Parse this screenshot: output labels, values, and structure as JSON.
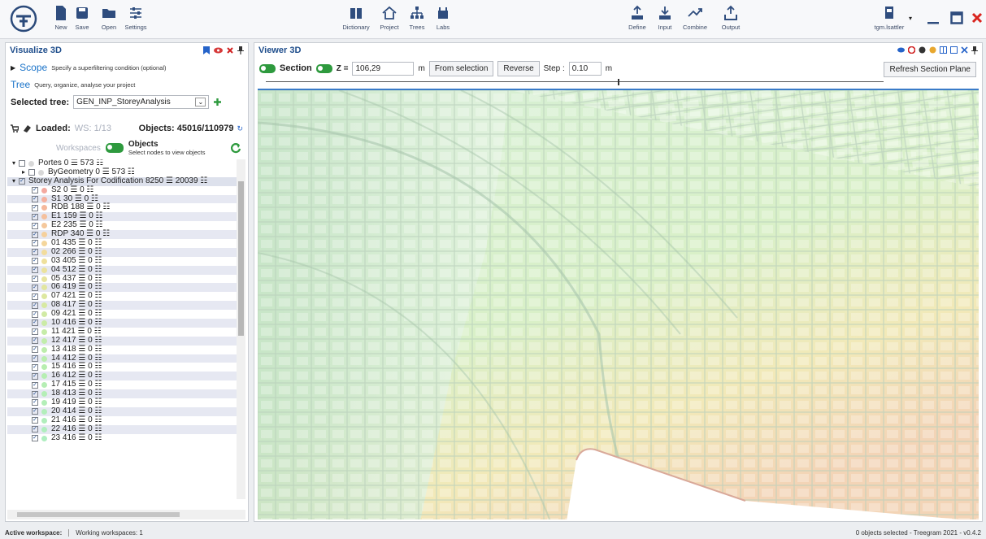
{
  "toolbar": {
    "new": "New",
    "save": "Save",
    "open": "Open",
    "settings": "Settings",
    "dictionary": "Dictionary",
    "project": "Project",
    "trees": "Trees",
    "labs": "Labs",
    "define": "Define",
    "input": "Input",
    "combine": "Combine",
    "output": "Output",
    "user": "tgm.lsattler"
  },
  "left": {
    "title": "Visualize 3D",
    "scope_label": "Scope",
    "scope_hint": "Specify a superfiltering condition (optional)",
    "tree_label": "Tree",
    "tree_hint": "Query, organize, analyse your project",
    "selected_tree_label": "Selected tree:",
    "selected_tree_value": "GEN_INP_StoreyAnalysis",
    "loaded_label": "Loaded:",
    "loaded_ws": "WS: 1/13",
    "objects_count": "Objects: 45016/110979",
    "workspaces_label": "Workspaces",
    "objects_label": "Objects",
    "objects_hint": "Select nodes to view objects"
  },
  "tree": [
    {
      "indent": 6,
      "arrow": "▾",
      "check": "",
      "color": "#d8d8d8",
      "label": "Portes   0 ☰ 573 ☷"
    },
    {
      "indent": 18,
      "arrow": "▸",
      "check": "",
      "color": "#d8d8d8",
      "label": "ByGeometry   0 ☰ 573 ☷"
    },
    {
      "indent": 6,
      "arrow": "▾",
      "check": "✓",
      "color": "",
      "label": "Storey Analysis For Codification   8250 ☰ 20039 ☷"
    },
    {
      "indent": 30,
      "arrow": "",
      "check": "✓",
      "color": "#f4a9a0",
      "label": "S2   0 ☰ 0 ☷"
    },
    {
      "indent": 30,
      "arrow": "",
      "check": "✓",
      "color": "#f5b09e",
      "label": "S1   30 ☰ 0 ☷"
    },
    {
      "indent": 30,
      "arrow": "",
      "check": "✓",
      "color": "#f5b89c",
      "label": "RDB   188 ☰ 0 ☷"
    },
    {
      "indent": 30,
      "arrow": "",
      "check": "✓",
      "color": "#f5c09c",
      "label": "E1   159 ☰ 0 ☷"
    },
    {
      "indent": 30,
      "arrow": "",
      "check": "✓",
      "color": "#f5c89c",
      "label": "E2   235 ☰ 0 ☷"
    },
    {
      "indent": 30,
      "arrow": "",
      "check": "✓",
      "color": "#f5d09c",
      "label": "RDP   340 ☰ 0 ☷"
    },
    {
      "indent": 30,
      "arrow": "",
      "check": "✓",
      "color": "#f4d69c",
      "label": "01   435 ☰ 0 ☷"
    },
    {
      "indent": 30,
      "arrow": "",
      "check": "✓",
      "color": "#f2dc9c",
      "label": "02   266 ☰ 0 ☷"
    },
    {
      "indent": 30,
      "arrow": "",
      "check": "✓",
      "color": "#efe09c",
      "label": "03   405 ☰ 0 ☷"
    },
    {
      "indent": 30,
      "arrow": "",
      "check": "✓",
      "color": "#ebe29c",
      "label": "04   512 ☰ 0 ☷"
    },
    {
      "indent": 30,
      "arrow": "",
      "check": "✓",
      "color": "#e7e49e",
      "label": "05   437 ☰ 0 ☷"
    },
    {
      "indent": 30,
      "arrow": "",
      "check": "✓",
      "color": "#e2e69f",
      "label": "06   419 ☰ 0 ☷"
    },
    {
      "indent": 30,
      "arrow": "",
      "check": "✓",
      "color": "#dde8a0",
      "label": "07   421 ☰ 0 ☷"
    },
    {
      "indent": 30,
      "arrow": "",
      "check": "✓",
      "color": "#d7e9a2",
      "label": "08   417 ☰ 0 ☷"
    },
    {
      "indent": 30,
      "arrow": "",
      "check": "✓",
      "color": "#d1eaa4",
      "label": "09   421 ☰ 0 ☷"
    },
    {
      "indent": 30,
      "arrow": "",
      "check": "✓",
      "color": "#cbeba6",
      "label": "10   416 ☰ 0 ☷"
    },
    {
      "indent": 30,
      "arrow": "",
      "check": "✓",
      "color": "#c6eca8",
      "label": "11   421 ☰ 0 ☷"
    },
    {
      "indent": 30,
      "arrow": "",
      "check": "✓",
      "color": "#c1edaa",
      "label": "12   417 ☰ 0 ☷"
    },
    {
      "indent": 30,
      "arrow": "",
      "check": "✓",
      "color": "#bdedac",
      "label": "13   418 ☰ 0 ☷"
    },
    {
      "indent": 30,
      "arrow": "",
      "check": "✓",
      "color": "#baeeae",
      "label": "14   412 ☰ 0 ☷"
    },
    {
      "indent": 30,
      "arrow": "",
      "check": "✓",
      "color": "#b8eeb0",
      "label": "15   416 ☰ 0 ☷"
    },
    {
      "indent": 30,
      "arrow": "",
      "check": "✓",
      "color": "#b6eeb2",
      "label": "16   412 ☰ 0 ☷"
    },
    {
      "indent": 30,
      "arrow": "",
      "check": "✓",
      "color": "#b5eeb4",
      "label": "17   415 ☰ 0 ☷"
    },
    {
      "indent": 30,
      "arrow": "",
      "check": "✓",
      "color": "#b4eeb6",
      "label": "18   413 ☰ 0 ☷"
    },
    {
      "indent": 30,
      "arrow": "",
      "check": "✓",
      "color": "#b3eeb8",
      "label": "19   419 ☰ 0 ☷"
    },
    {
      "indent": 30,
      "arrow": "",
      "check": "✓",
      "color": "#b2eeba",
      "label": "20   414 ☰ 0 ☷"
    },
    {
      "indent": 30,
      "arrow": "",
      "check": "✓",
      "color": "#b1eebc",
      "label": "21   416 ☰ 0 ☷"
    },
    {
      "indent": 30,
      "arrow": "",
      "check": "✓",
      "color": "#b0eebe",
      "label": "22   416 ☰ 0 ☷"
    },
    {
      "indent": 30,
      "arrow": "",
      "check": "✓",
      "color": "#afeec0",
      "label": "23   416 ☰ 0 ☷"
    }
  ],
  "viewer": {
    "title": "Viewer 3D",
    "section_label": "Section",
    "z_label": "Z =",
    "z_value": "106,29",
    "unit_m": "m",
    "from_selection": "From selection",
    "reverse": "Reverse",
    "step_label": "Step :",
    "step_value": "0.10",
    "unit_m2": "m",
    "refresh": "Refresh Section Plane",
    "section_position": 0.57
  },
  "status": {
    "active_workspace": "Active workspace:",
    "working_workspaces": "Working workspaces: 1",
    "right": "0 objects selected  -  Treegram 2021 - v0.4.2"
  }
}
